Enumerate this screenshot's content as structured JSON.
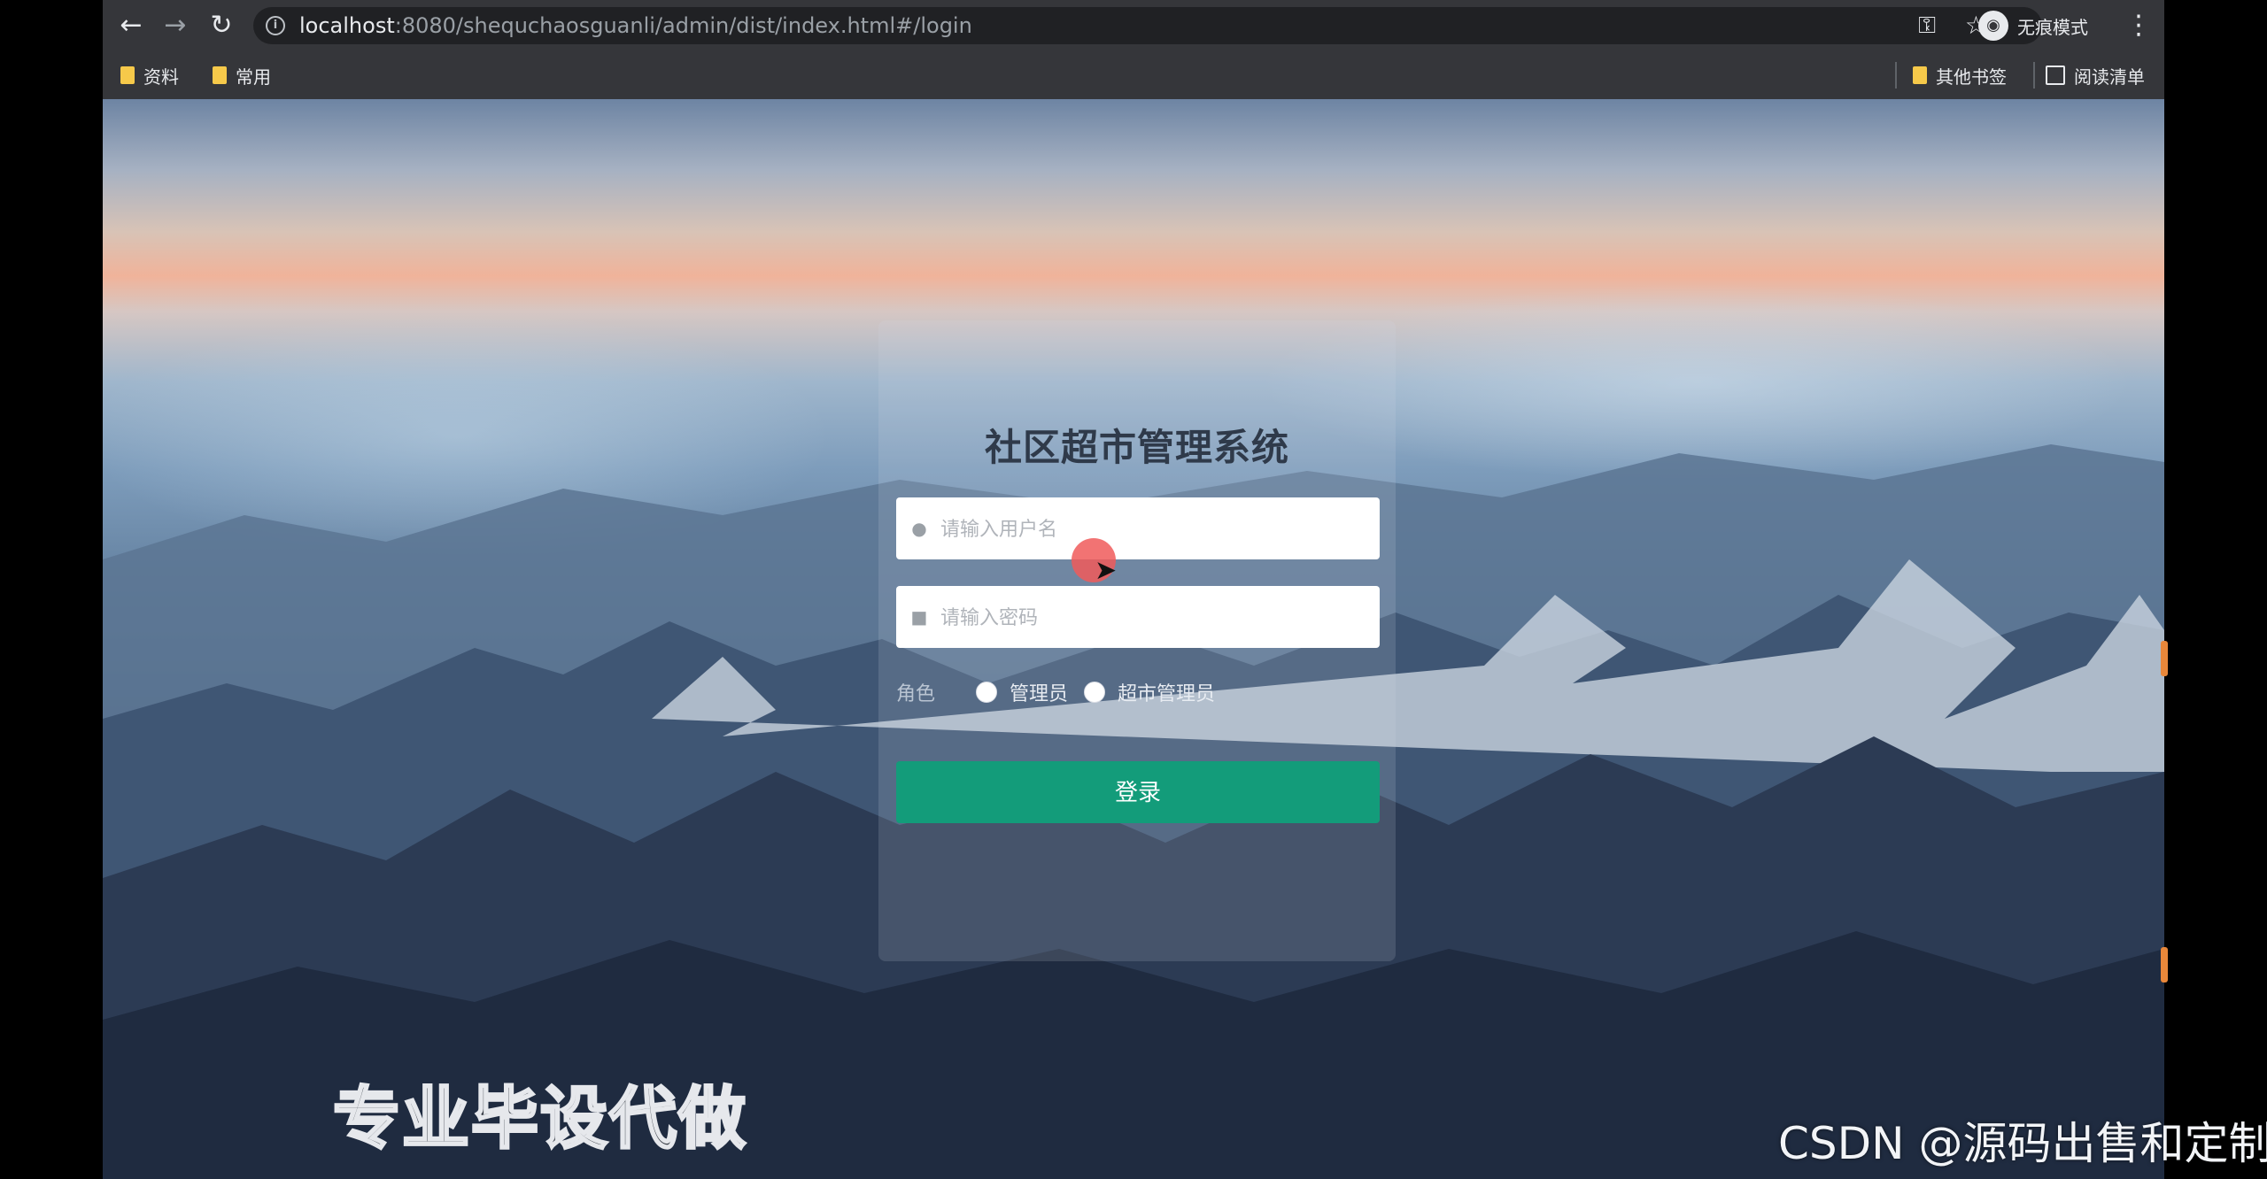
{
  "browser": {
    "url_host": "localhost",
    "url_rest": ":8080/shequchaosguanli/admin/dist/index.html#/login",
    "incognito_label": "无痕模式",
    "bookmarks": [
      "资料",
      "常用"
    ],
    "other_bookmarks": "其他书签",
    "reading_list": "阅读清单"
  },
  "login": {
    "title": "社区超市管理系统",
    "username_placeholder": "请输入用户名",
    "password_placeholder": "请输入密码",
    "role_label": "角色",
    "roles": [
      "管理员",
      "超市管理员"
    ],
    "submit_label": "登录"
  },
  "overlay": {
    "promo_text": "专业毕设代做",
    "credit_text": "CSDN @源码出售和定制"
  },
  "colors": {
    "button": "#139c7a",
    "title": "#2f3a4a"
  }
}
